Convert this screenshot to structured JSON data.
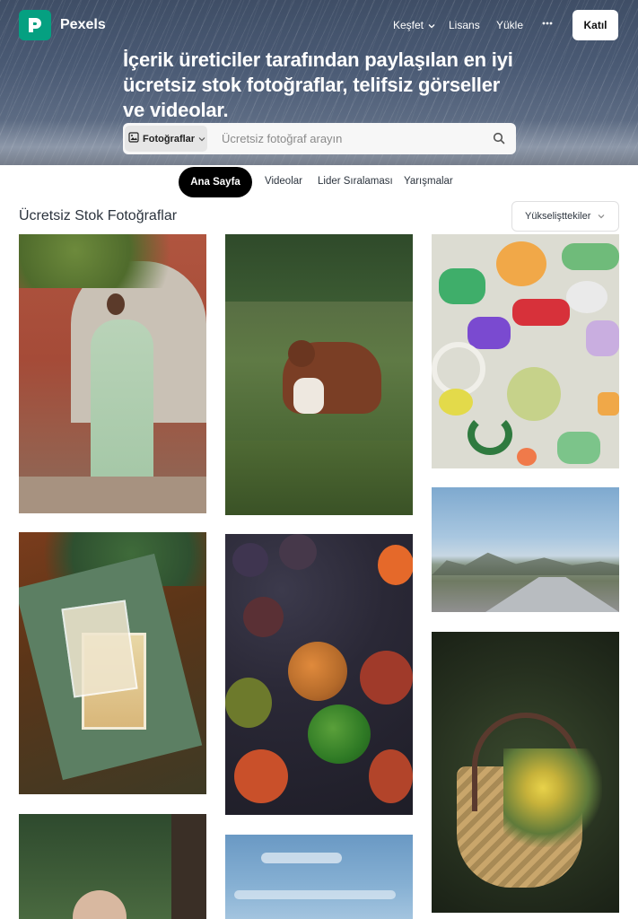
{
  "brand": {
    "name": "Pexels",
    "accent": "#05a081"
  },
  "nav": {
    "explore_label": "Keşfet",
    "license_label": "Lisans",
    "upload_label": "Yükle",
    "more_icon": "ellipsis-icon",
    "join_label": "Katıl"
  },
  "hero": {
    "headline": "İçerik üreticiler tarafından paylaşılan en iyi ücretsiz stok fotoğraflar, telifsiz görseller ve videolar."
  },
  "search": {
    "type_label": "Fotoğraflar",
    "placeholder": "Ücretsiz fotoğraf arayın",
    "value": ""
  },
  "tabs": [
    {
      "label": "Ana Sayfa",
      "active": true
    },
    {
      "label": "Videolar",
      "active": false
    },
    {
      "label": "Lider Sıralaması",
      "active": false
    },
    {
      "label": "Yarışmalar",
      "active": false
    }
  ],
  "feed": {
    "title": "Ücretsiz Stok Fotoğraflar",
    "sort_label": "Yükselişttekiler"
  },
  "photos": [
    {
      "name": "woman-in-green-saree"
    },
    {
      "name": "border-collie-in-field"
    },
    {
      "name": "colorful-clay-shapes"
    },
    {
      "name": "mountain-highway"
    },
    {
      "name": "tarot-cards"
    },
    {
      "name": "heirloom-tomatoes"
    },
    {
      "name": "flower-basket"
    },
    {
      "name": "girl-portrait-trees"
    },
    {
      "name": "blue-sky-clouds"
    }
  ]
}
